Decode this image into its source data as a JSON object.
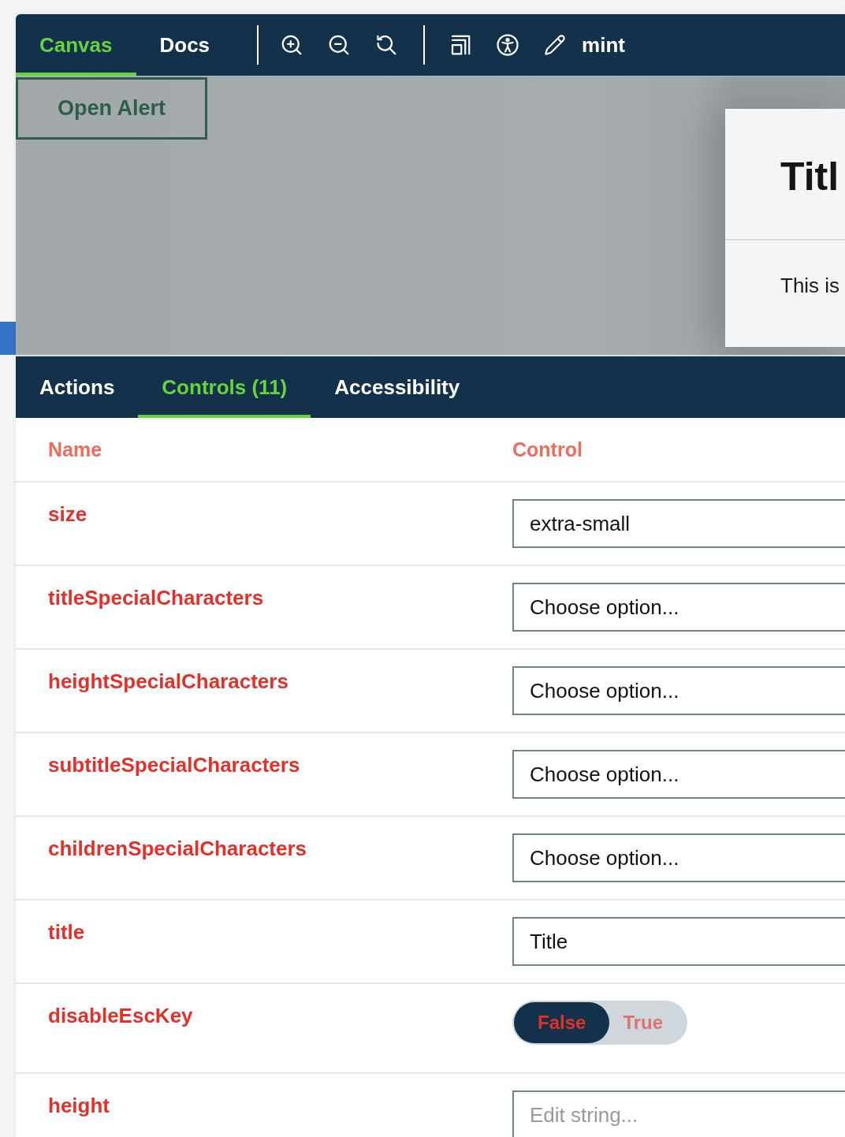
{
  "toolbar": {
    "tabs": [
      {
        "label": "Canvas",
        "selected": true
      },
      {
        "label": "Docs",
        "selected": false
      }
    ],
    "theme": "mint"
  },
  "canvas": {
    "button": "Open Alert",
    "modal": {
      "title": "Titl",
      "body": "This is"
    }
  },
  "panel_tabs": [
    {
      "label": "Actions",
      "selected": false
    },
    {
      "label": "Controls (11)",
      "selected": true
    },
    {
      "label": "Accessibility",
      "selected": false
    }
  ],
  "controls_table": {
    "columns": [
      "Name",
      "Control"
    ],
    "rows": [
      {
        "name": "size",
        "control": {
          "kind": "select",
          "value": "extra-small"
        }
      },
      {
        "name": "titleSpecialCharacters",
        "control": {
          "kind": "select",
          "value": "Choose option..."
        }
      },
      {
        "name": "heightSpecialCharacters",
        "control": {
          "kind": "select",
          "value": "Choose option..."
        }
      },
      {
        "name": "subtitleSpecialCharacters",
        "control": {
          "kind": "select",
          "value": "Choose option..."
        }
      },
      {
        "name": "childrenSpecialCharacters",
        "control": {
          "kind": "select",
          "value": "Choose option..."
        }
      },
      {
        "name": "title",
        "control": {
          "kind": "text",
          "value": "Title"
        }
      },
      {
        "name": "disableEscKey",
        "control": {
          "kind": "toggle",
          "options": [
            {
              "label": "False",
              "selected": true
            },
            {
              "label": "True",
              "selected": false
            }
          ]
        }
      },
      {
        "name": "height",
        "control": {
          "kind": "text",
          "placeholder": "Edit string..."
        }
      }
    ]
  }
}
